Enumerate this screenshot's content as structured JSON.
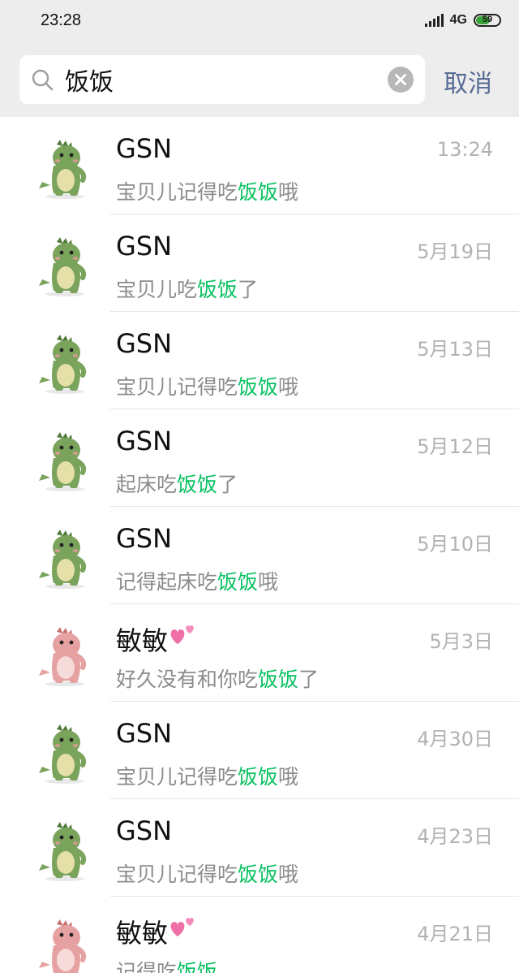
{
  "status_bar": {
    "time": "23:28",
    "network": "4G",
    "battery": "59"
  },
  "search": {
    "query": "饭饭",
    "cancel_label": "取消"
  },
  "results": [
    {
      "name": "GSN",
      "avatar": "green-dinosaur",
      "heart": false,
      "date": "13:24",
      "before": "宝贝儿记得吃",
      "match": "饭饭",
      "after": "哦"
    },
    {
      "name": "GSN",
      "avatar": "green-dinosaur",
      "heart": false,
      "date": "5月19日",
      "before": "宝贝儿吃",
      "match": "饭饭",
      "after": "了"
    },
    {
      "name": "GSN",
      "avatar": "green-dinosaur",
      "heart": false,
      "date": "5月13日",
      "before": "宝贝儿记得吃",
      "match": "饭饭",
      "after": "哦"
    },
    {
      "name": "GSN",
      "avatar": "green-dinosaur",
      "heart": false,
      "date": "5月12日",
      "before": "起床吃",
      "match": "饭饭",
      "after": "了"
    },
    {
      "name": "GSN",
      "avatar": "green-dinosaur",
      "heart": false,
      "date": "5月10日",
      "before": "记得起床吃",
      "match": "饭饭",
      "after": "哦"
    },
    {
      "name": "敏敏",
      "avatar": "pink-dinosaur",
      "heart": true,
      "date": "5月3日",
      "before": "好久没有和你吃",
      "match": "饭饭",
      "after": "了"
    },
    {
      "name": "GSN",
      "avatar": "green-dinosaur",
      "heart": false,
      "date": "4月30日",
      "before": "宝贝儿记得吃",
      "match": "饭饭",
      "after": "哦"
    },
    {
      "name": "GSN",
      "avatar": "green-dinosaur",
      "heart": false,
      "date": "4月23日",
      "before": "宝贝儿记得吃",
      "match": "饭饭",
      "after": "哦"
    },
    {
      "name": "敏敏",
      "avatar": "pink-dinosaur",
      "heart": true,
      "date": "4月21日",
      "before": "记得吃",
      "match": "饭饭",
      "after": ""
    }
  ],
  "colors": {
    "highlight": "#07c160",
    "cancel": "#576b95",
    "header_bg": "#ededed",
    "green_dino": "#7aa35c",
    "pink_dino": "#e6a2a2"
  }
}
